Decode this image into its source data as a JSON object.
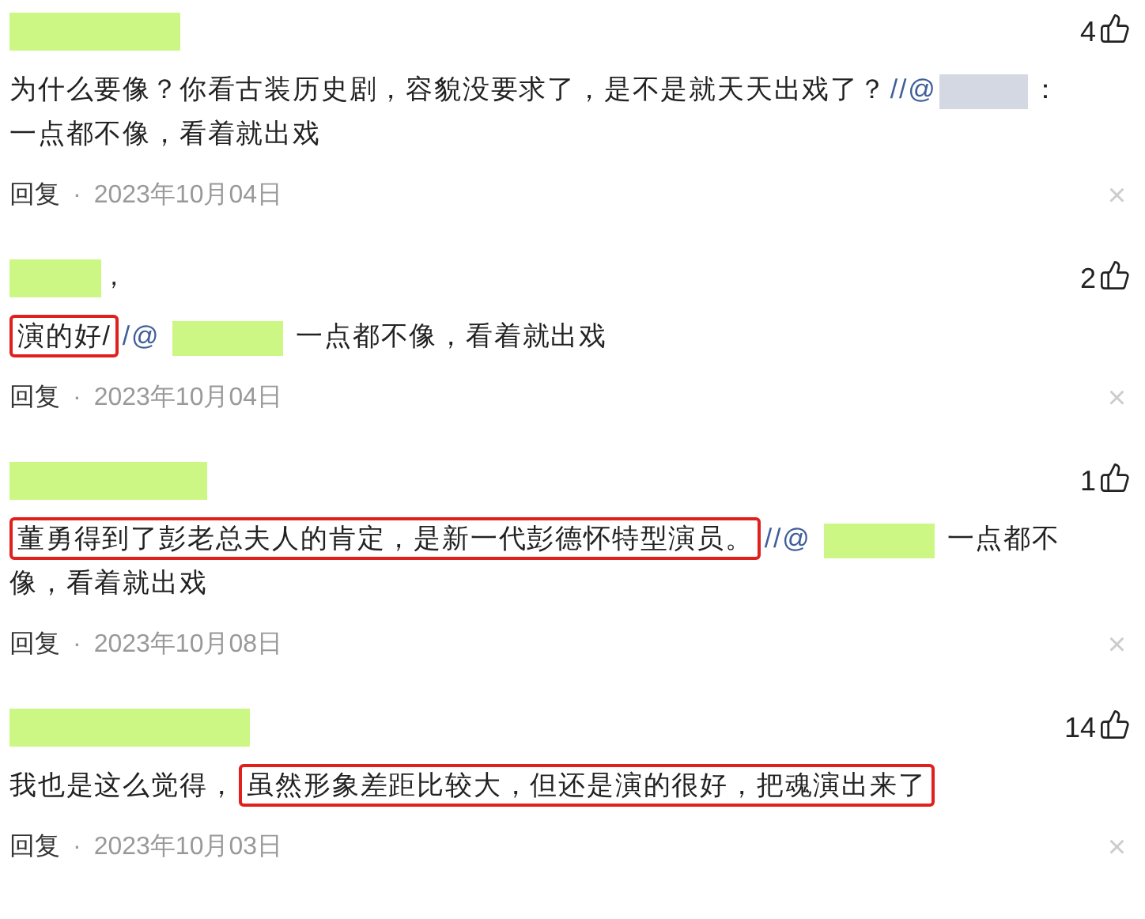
{
  "comments": [
    {
      "likes": "4",
      "lines": [
        [
          {
            "kind": "text",
            "text": "为什么要像？你看古装历史剧，容貌没要求了，是不是就天天出戏了？",
            "highlighted": false
          },
          {
            "kind": "mention",
            "text": "//@"
          },
          {
            "kind": "blurred"
          },
          {
            "kind": "text",
            "text": "：",
            "highlighted": false
          }
        ],
        [
          {
            "kind": "text",
            "text": "一点都不像，看着就出戏",
            "highlighted": false
          }
        ]
      ],
      "reply": "回复",
      "separator": "·",
      "date": "2023年10月04日",
      "close": "×"
    },
    {
      "name_suffix": "，",
      "likes": "2",
      "lines": [
        [
          {
            "kind": "text",
            "text": "演的好/",
            "highlighted": true
          },
          {
            "kind": "mention",
            "text": "/@"
          },
          {
            "kind": "redacted"
          },
          {
            "kind": "text",
            "text": "一点都不像，看着就出戏",
            "highlighted": false
          }
        ]
      ],
      "reply": "回复",
      "separator": "·",
      "date": "2023年10月04日",
      "close": "×"
    },
    {
      "likes": "1",
      "lines": [
        [
          {
            "kind": "text",
            "text": "董勇得到了彭老总夫人的肯定，是新一代彭德怀特型演员。",
            "highlighted": true
          },
          {
            "kind": "mention",
            "text": "//@"
          },
          {
            "kind": "redacted"
          },
          {
            "kind": "text",
            "text": "一点都不",
            "highlighted": false
          }
        ],
        [
          {
            "kind": "text",
            "text": "像，看着就出戏",
            "highlighted": false
          }
        ]
      ],
      "reply": "回复",
      "separator": "·",
      "date": "2023年10月08日",
      "close": "×"
    },
    {
      "likes": "14",
      "lines": [
        [
          {
            "kind": "text",
            "text": "我也是这么觉得，",
            "highlighted": false
          },
          {
            "kind": "text",
            "text": "虽然形象差距比较大，但还是演的很好，把魂演出来了",
            "highlighted": true
          }
        ]
      ],
      "reply": "回复",
      "separator": "·",
      "date": "2023年10月03日",
      "close": "×"
    }
  ]
}
